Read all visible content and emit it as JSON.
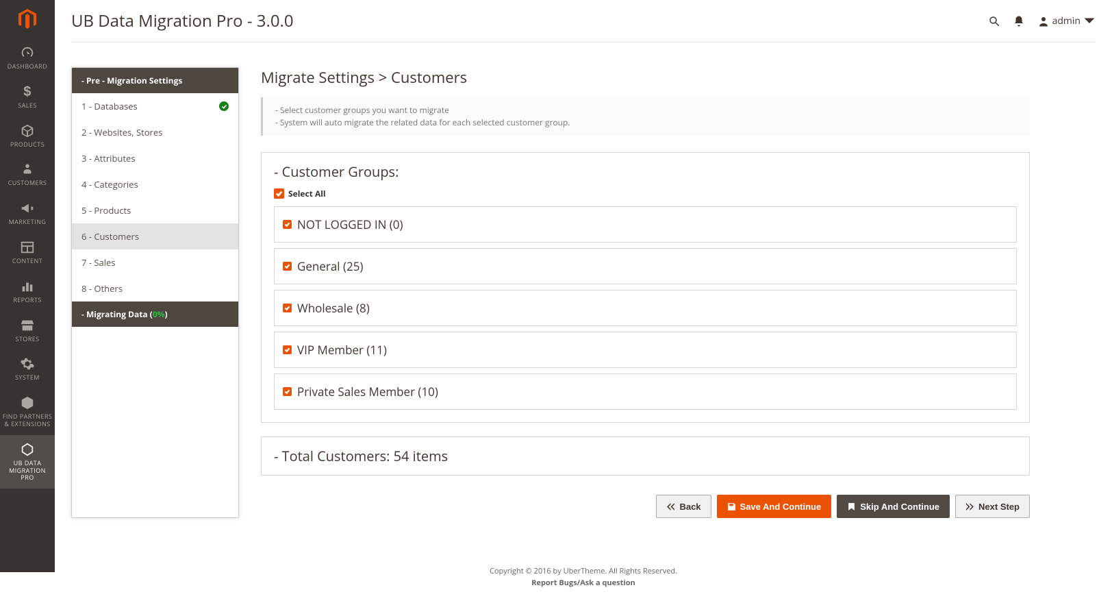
{
  "nav": {
    "items": [
      {
        "label": "DASHBOARD"
      },
      {
        "label": "SALES"
      },
      {
        "label": "PRODUCTS"
      },
      {
        "label": "CUSTOMERS"
      },
      {
        "label": "MARKETING"
      },
      {
        "label": "CONTENT"
      },
      {
        "label": "REPORTS"
      },
      {
        "label": "STORES"
      },
      {
        "label": "SYSTEM"
      },
      {
        "label": "FIND PARTNERS & EXTENSIONS"
      },
      {
        "label": "UB DATA MIGRATION PRO"
      }
    ]
  },
  "header": {
    "title": "UB Data Migration Pro - 3.0.0",
    "user": "admin"
  },
  "steps": {
    "head1": "- Pre - Migration Settings",
    "list": [
      {
        "label": "1 - Databases",
        "done": true
      },
      {
        "label": "2 - Websites, Stores"
      },
      {
        "label": "3 - Attributes"
      },
      {
        "label": "4 - Categories"
      },
      {
        "label": "5 - Products"
      },
      {
        "label": "6 - Customers",
        "active": true
      },
      {
        "label": "7 - Sales"
      },
      {
        "label": "8 - Others"
      }
    ],
    "head2_pre": "- Migrating Data (",
    "head2_pct": "0%",
    "head2_post": ")"
  },
  "main": {
    "title": "Migrate Settings > Customers",
    "hint1": "- Select customer groups you want to migrate",
    "hint2": "- System will auto migrate the related data for each selected customer group.",
    "groups_heading": "- Customer Groups:",
    "select_all": "Select All",
    "groups": [
      {
        "label": "NOT LOGGED IN (0)"
      },
      {
        "label": "General (25)"
      },
      {
        "label": "Wholesale (8)"
      },
      {
        "label": "VIP Member (11)"
      },
      {
        "label": "Private Sales Member (10)"
      }
    ],
    "total": "- Total Customers: 54 items",
    "buttons": {
      "back": "Back",
      "save": "Save And Continue",
      "skip": "Skip And Continue",
      "next": "Next Step"
    }
  },
  "footer": {
    "line1": "Copyright © 2016 by UberTheme. All Rights Reserved.",
    "line2": "Report Bugs/Ask a question"
  }
}
